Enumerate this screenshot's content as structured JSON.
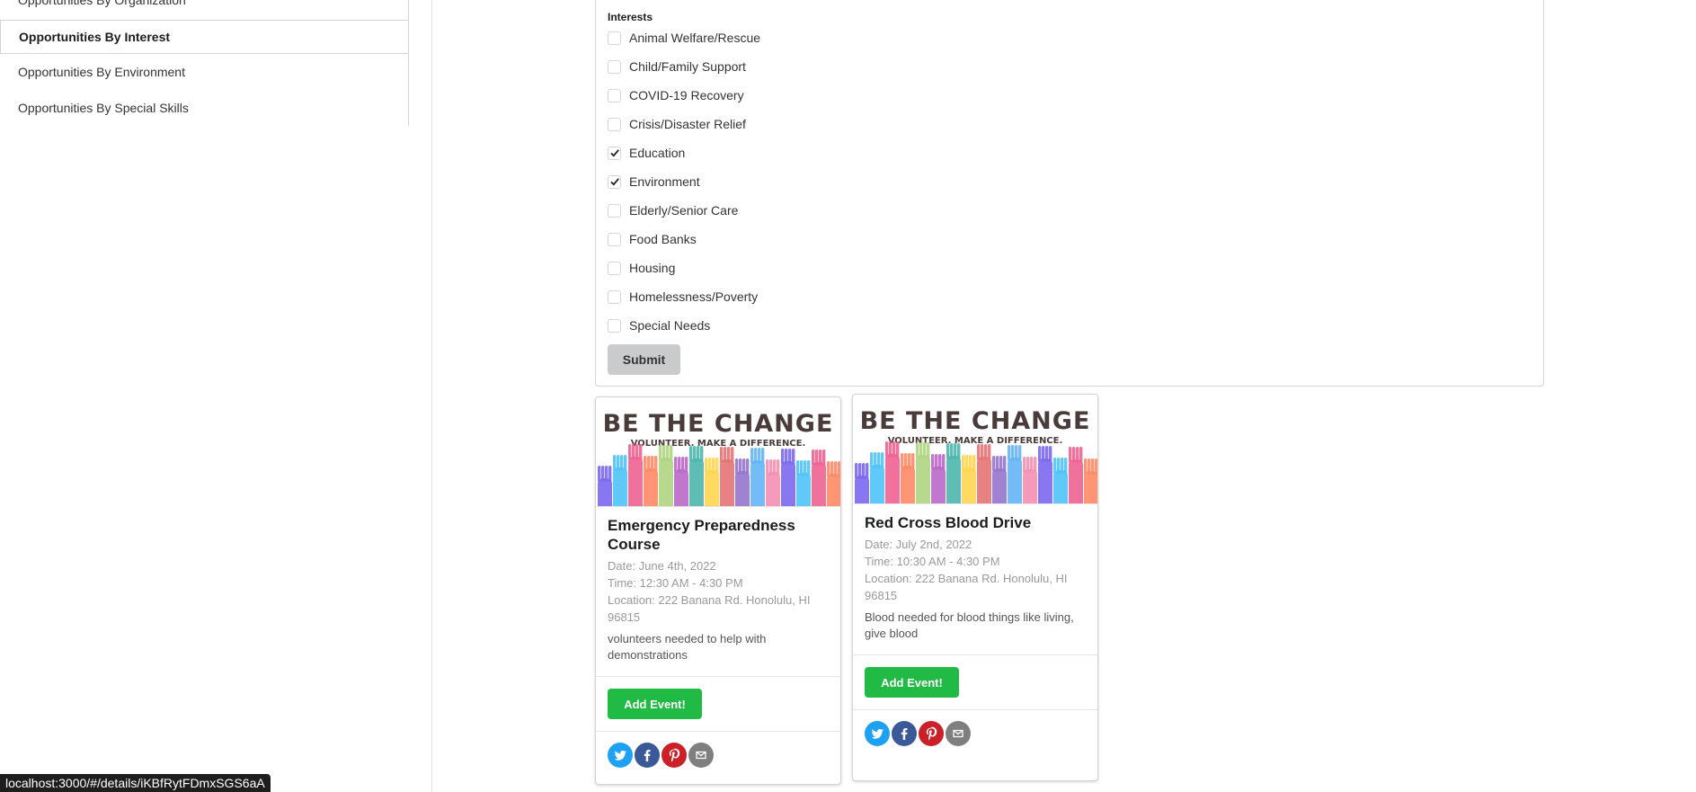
{
  "sidebar": {
    "items": [
      {
        "label": "Opportunities By Organization"
      },
      {
        "label": "Opportunities By Interest"
      },
      {
        "label": "Opportunities By Environment"
      },
      {
        "label": "Opportunities By Special Skills"
      }
    ]
  },
  "form": {
    "label": "Interests",
    "options": [
      {
        "label": "Animal Welfare/Rescue",
        "checked": false
      },
      {
        "label": "Child/Family Support",
        "checked": false
      },
      {
        "label": "COVID-19 Recovery",
        "checked": false
      },
      {
        "label": "Crisis/Disaster Relief",
        "checked": false
      },
      {
        "label": "Education",
        "checked": true
      },
      {
        "label": "Environment",
        "checked": true
      },
      {
        "label": "Elderly/Senior Care",
        "checked": false
      },
      {
        "label": "Food Banks",
        "checked": false
      },
      {
        "label": "Housing",
        "checked": false
      },
      {
        "label": "Homelessness/Poverty",
        "checked": false
      },
      {
        "label": "Special Needs",
        "checked": false
      }
    ],
    "submit_label": "Submit"
  },
  "banner": {
    "headline": "BE THE CHANGE",
    "tagline": "VOLUNTEER. MAKE A DIFFERENCE."
  },
  "cards": [
    {
      "title": "Emergency Preparedness Course",
      "date": "Date: June 4th, 2022",
      "time": "Time: 12:30 AM - 4:30 PM",
      "location": "Location: 222 Banana Rd. Honolulu, HI 96815",
      "description": "volunteers needed to help with demonstrations",
      "button_label": "Add Event!"
    },
    {
      "title": "Red Cross Blood Drive",
      "date": "Date: July 2nd, 2022",
      "time": "Time: 10:30 AM - 4:30 PM",
      "location": "Location: 222 Banana Rd. Honolulu, HI 96815",
      "description": "Blood needed for blood things like living, give blood",
      "button_label": "Add Event!"
    }
  ],
  "share_icons": [
    {
      "name": "twitter-icon",
      "color": "#1da1f2"
    },
    {
      "name": "facebook-icon",
      "color": "#3b5998"
    },
    {
      "name": "pinterest-icon",
      "color": "#cb2027"
    },
    {
      "name": "email-icon",
      "color": "#7f7f7f"
    }
  ],
  "colors": {
    "add_button": "#21ba45",
    "submit_button": "#cacbcd",
    "hand_colors": [
      "#7b68ee",
      "#4fc3f7",
      "#f06292",
      "#ff8a65",
      "#aed581",
      "#ba68c8",
      "#4db6ac",
      "#ffd54f",
      "#e57373",
      "#9575cd",
      "#64b5f6",
      "#f48fb1"
    ]
  },
  "status_bar": {
    "url": "localhost:3000/#/details/iKBfRytFDmxSGS6aA"
  }
}
